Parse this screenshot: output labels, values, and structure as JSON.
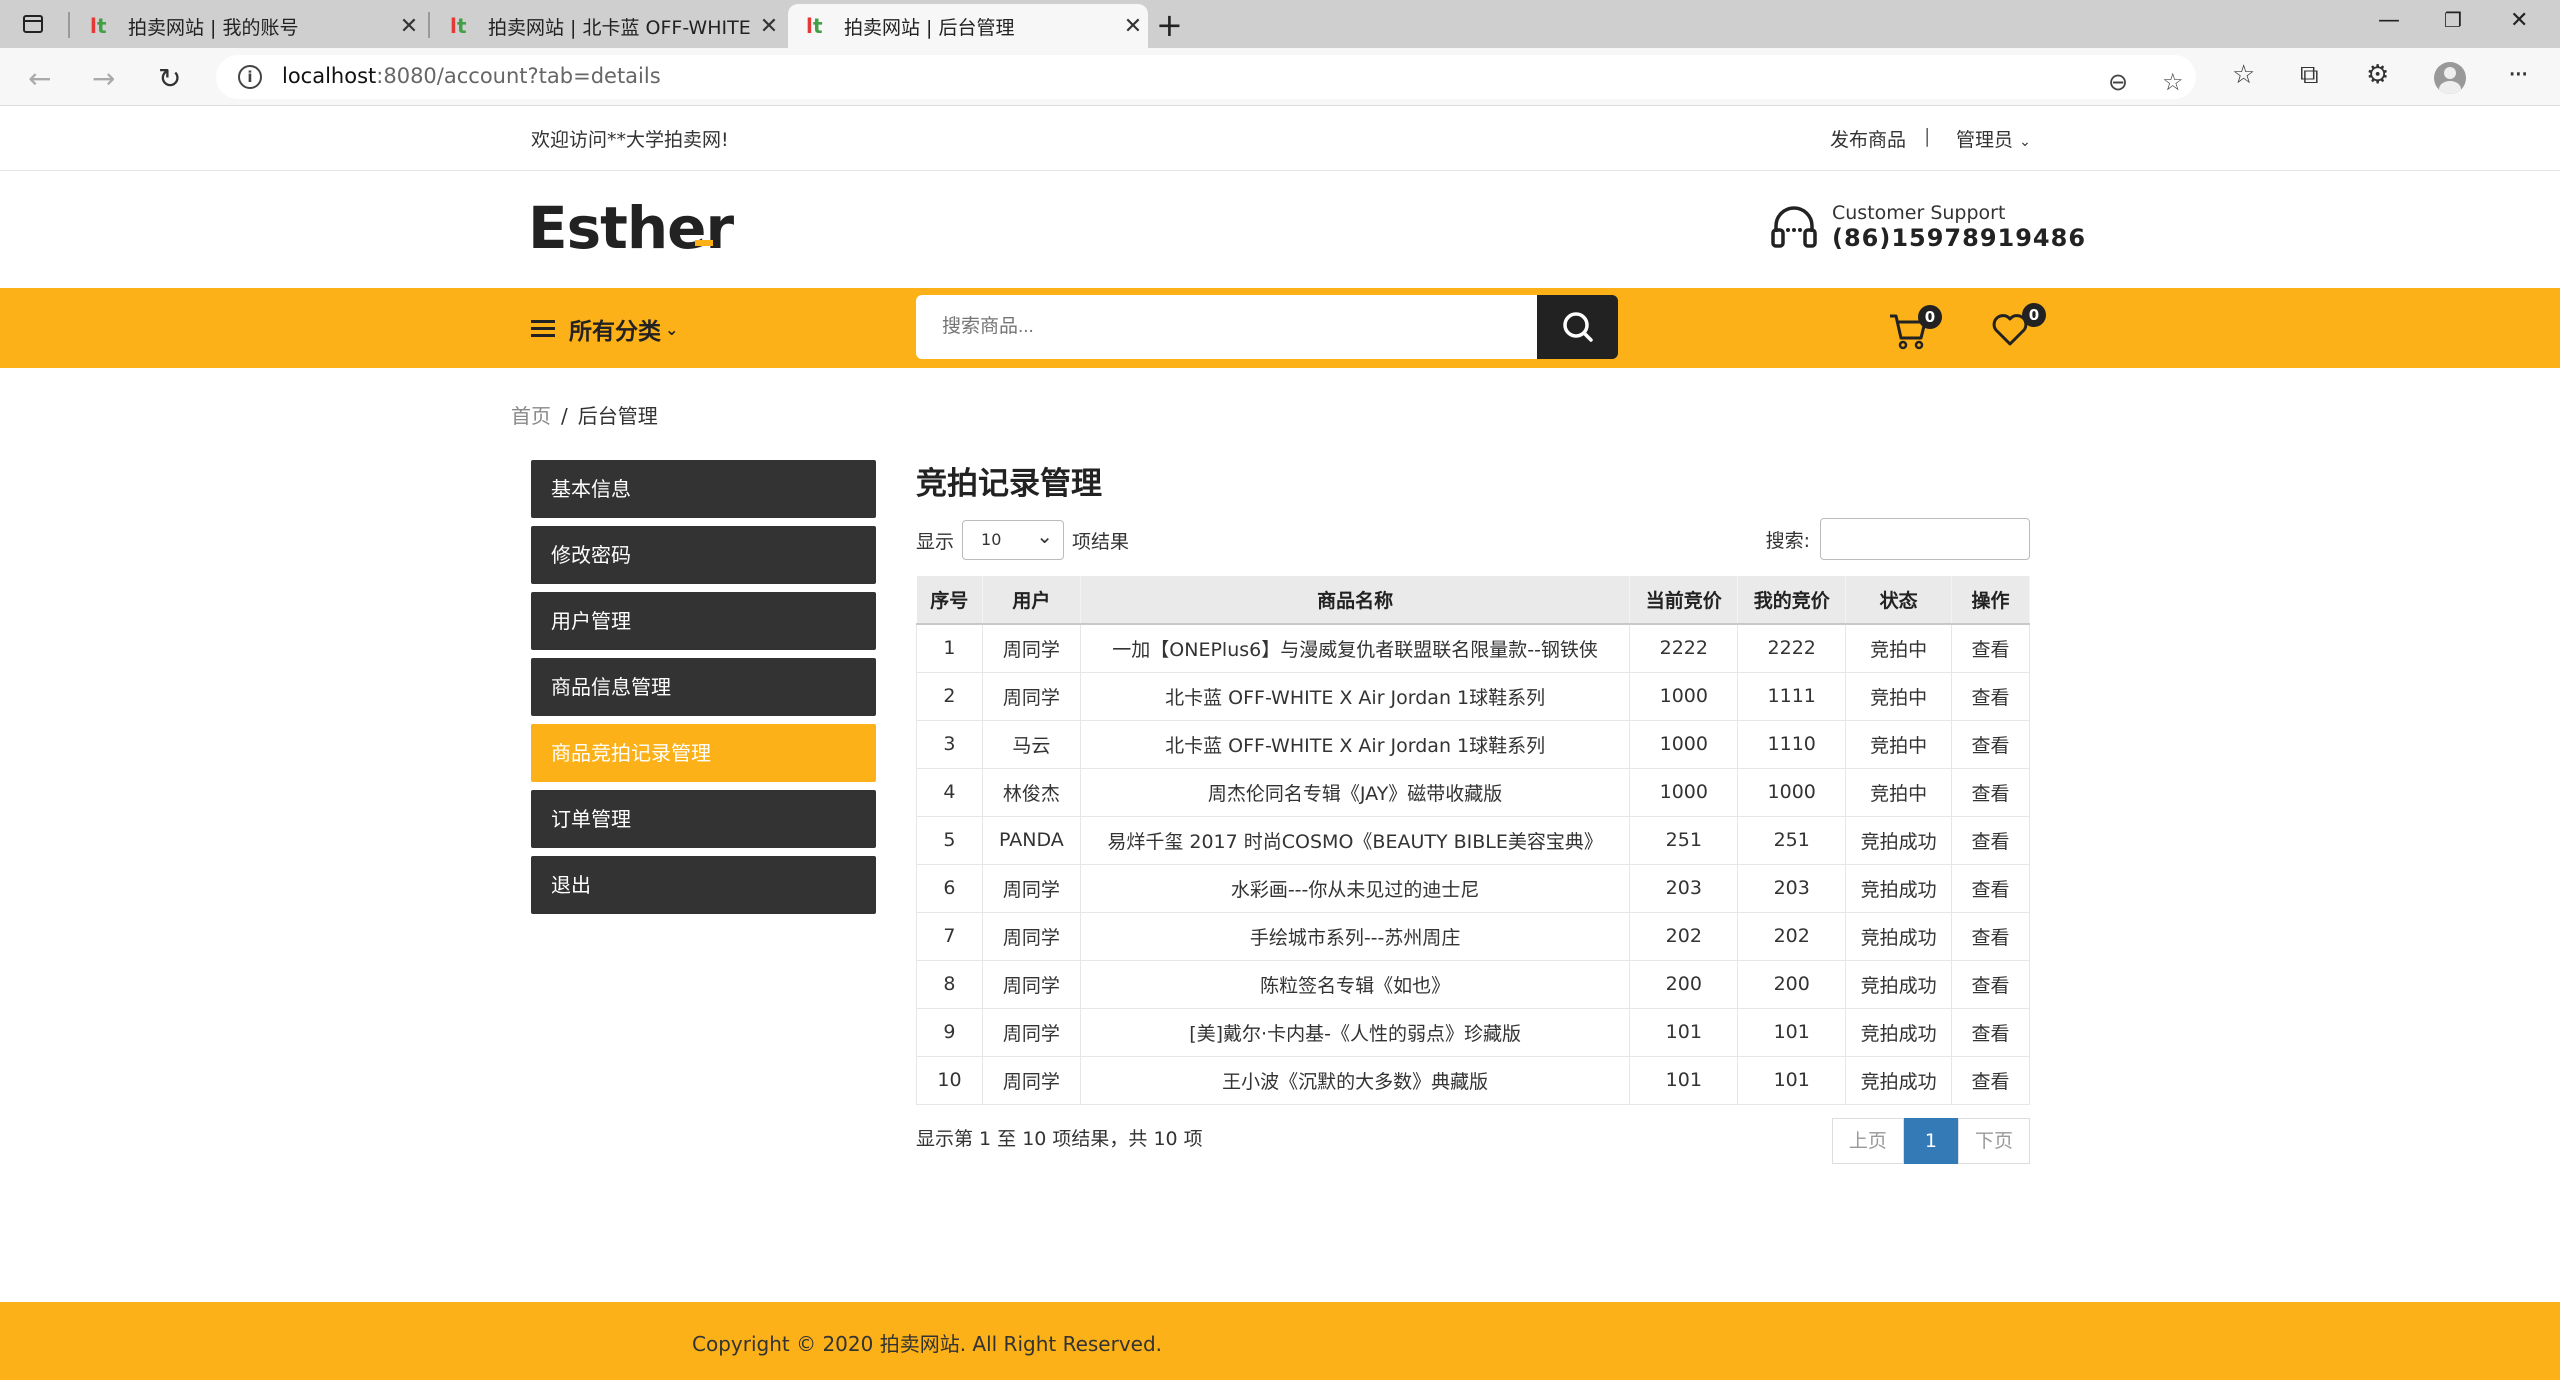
{
  "browser": {
    "tabs": [
      {
        "title": "拍卖网站 | 我的账号"
      },
      {
        "title": "拍卖网站 | 北卡蓝 OFF-WHITE x /"
      },
      {
        "title": "拍卖网站 | 后台管理"
      }
    ],
    "url_host": "localhost",
    "url_path": ":8080/account?tab=details"
  },
  "topbar": {
    "welcome": "欢迎访问**大学拍卖网!",
    "publish": "发布商品",
    "divider": "|",
    "admin": "管理员"
  },
  "header": {
    "logo": "Esther",
    "support_label": "Customer Support",
    "support_phone": "(86)15978919486"
  },
  "nav": {
    "categories": "所有分类",
    "search_placeholder": "搜索商品...",
    "cart_count": "0",
    "wish_count": "0"
  },
  "breadcrumb": {
    "home": "首页",
    "sep": "/",
    "current": "后台管理"
  },
  "sidebar": {
    "items": [
      {
        "label": "基本信息",
        "active": false
      },
      {
        "label": "修改密码",
        "active": false
      },
      {
        "label": "用户管理",
        "active": false
      },
      {
        "label": "商品信息管理",
        "active": false
      },
      {
        "label": "商品竞拍记录管理",
        "active": true
      },
      {
        "label": "订单管理",
        "active": false
      },
      {
        "label": "退出",
        "active": false
      }
    ]
  },
  "content": {
    "title": "竞拍记录管理",
    "show_label": "显示",
    "page_size": "10",
    "results_label": "项结果",
    "search_label": "搜索:",
    "columns": [
      "序号",
      "用户",
      "商品名称",
      "当前竞价",
      "我的竞价",
      "状态",
      "操作"
    ],
    "rows": [
      {
        "no": "1",
        "user": "周同学",
        "name": "一加【ONEPlus6】与漫威复仇者联盟联名限量款--钢铁侠",
        "current": "2222",
        "mine": "2222",
        "status": "竞拍中",
        "status_type": "bidding",
        "action": "查看"
      },
      {
        "no": "2",
        "user": "周同学",
        "name": "北卡蓝 OFF-WHITE X Air Jordan 1球鞋系列",
        "current": "1000",
        "mine": "1111",
        "status": "竞拍中",
        "status_type": "bidding",
        "action": "查看"
      },
      {
        "no": "3",
        "user": "马云",
        "name": "北卡蓝 OFF-WHITE X Air Jordan 1球鞋系列",
        "current": "1000",
        "mine": "1110",
        "status": "竞拍中",
        "status_type": "bidding",
        "action": "查看"
      },
      {
        "no": "4",
        "user": "林俊杰",
        "name": "周杰伦同名专辑《JAY》磁带收藏版",
        "current": "1000",
        "mine": "1000",
        "status": "竞拍中",
        "status_type": "bidding",
        "action": "查看"
      },
      {
        "no": "5",
        "user": "PANDA",
        "name": "易烊千玺 2017 时尚COSMO《BEAUTY BIBLE美容宝典》",
        "current": "251",
        "mine": "251",
        "status": "竞拍成功",
        "status_type": "success",
        "action": "查看"
      },
      {
        "no": "6",
        "user": "周同学",
        "name": "水彩画---你从未见过的迪士尼",
        "current": "203",
        "mine": "203",
        "status": "竞拍成功",
        "status_type": "success",
        "action": "查看"
      },
      {
        "no": "7",
        "user": "周同学",
        "name": "手绘城市系列---苏州周庄",
        "current": "202",
        "mine": "202",
        "status": "竞拍成功",
        "status_type": "success",
        "action": "查看"
      },
      {
        "no": "8",
        "user": "周同学",
        "name": "陈粒签名专辑《如也》",
        "current": "200",
        "mine": "200",
        "status": "竞拍成功",
        "status_type": "success",
        "action": "查看"
      },
      {
        "no": "9",
        "user": "周同学",
        "name": "[美]戴尔·卡内基-《人性的弱点》珍藏版",
        "current": "101",
        "mine": "101",
        "status": "竞拍成功",
        "status_type": "success",
        "action": "查看"
      },
      {
        "no": "10",
        "user": "周同学",
        "name": "王小波《沉默的大多数》典藏版",
        "current": "101",
        "mine": "101",
        "status": "竞拍成功",
        "status_type": "success",
        "action": "查看"
      }
    ],
    "info": "显示第 1 至 10 项结果，共 10 项",
    "pager": {
      "prev": "上页",
      "current": "1",
      "next": "下页"
    }
  },
  "footer": {
    "copyright": "Copyright © 2020 拍卖网站. All Right Reserved."
  },
  "colors": {
    "accent": "#fbb117",
    "dark": "#333333",
    "status_bidding": "#3a7fc4",
    "status_success": "#3c9a35",
    "pager_active": "#337ab7"
  }
}
